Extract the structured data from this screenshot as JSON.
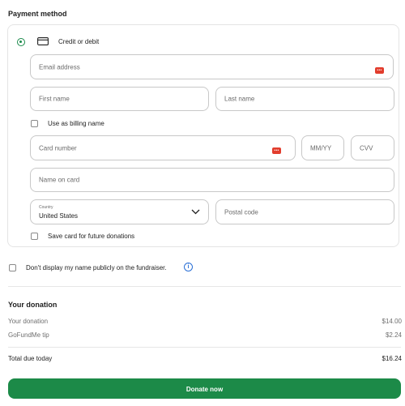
{
  "payment": {
    "title": "Payment method",
    "option_label": "Credit or debit",
    "email_placeholder": "Email address",
    "first_name_placeholder": "First name",
    "last_name_placeholder": "Last name",
    "billing_name_label": "Use as billing name",
    "card_number_placeholder": "Card number",
    "expiry_placeholder": "MM/YY",
    "cvv_placeholder": "CVV",
    "name_on_card_placeholder": "Name on card",
    "country_label": "Country",
    "country_value": "United States",
    "postal_code_placeholder": "Postal code",
    "save_card_label": "Save card for future donations",
    "autofill_badge": "•••"
  },
  "privacy": {
    "label": "Don't display my name publicly on the fundraiser.",
    "info_icon": "i"
  },
  "donation": {
    "title": "Your donation",
    "rows": [
      {
        "label": "Your donation",
        "value": "$14.00"
      },
      {
        "label": "GoFundMe tip",
        "value": "$2.24"
      }
    ],
    "total_label": "Total due today",
    "total_value": "$16.24"
  },
  "cta": {
    "label": "Donate now"
  },
  "colors": {
    "accent": "#1c8a48",
    "badge": "#e23d2d",
    "info": "#2a6fd6"
  }
}
